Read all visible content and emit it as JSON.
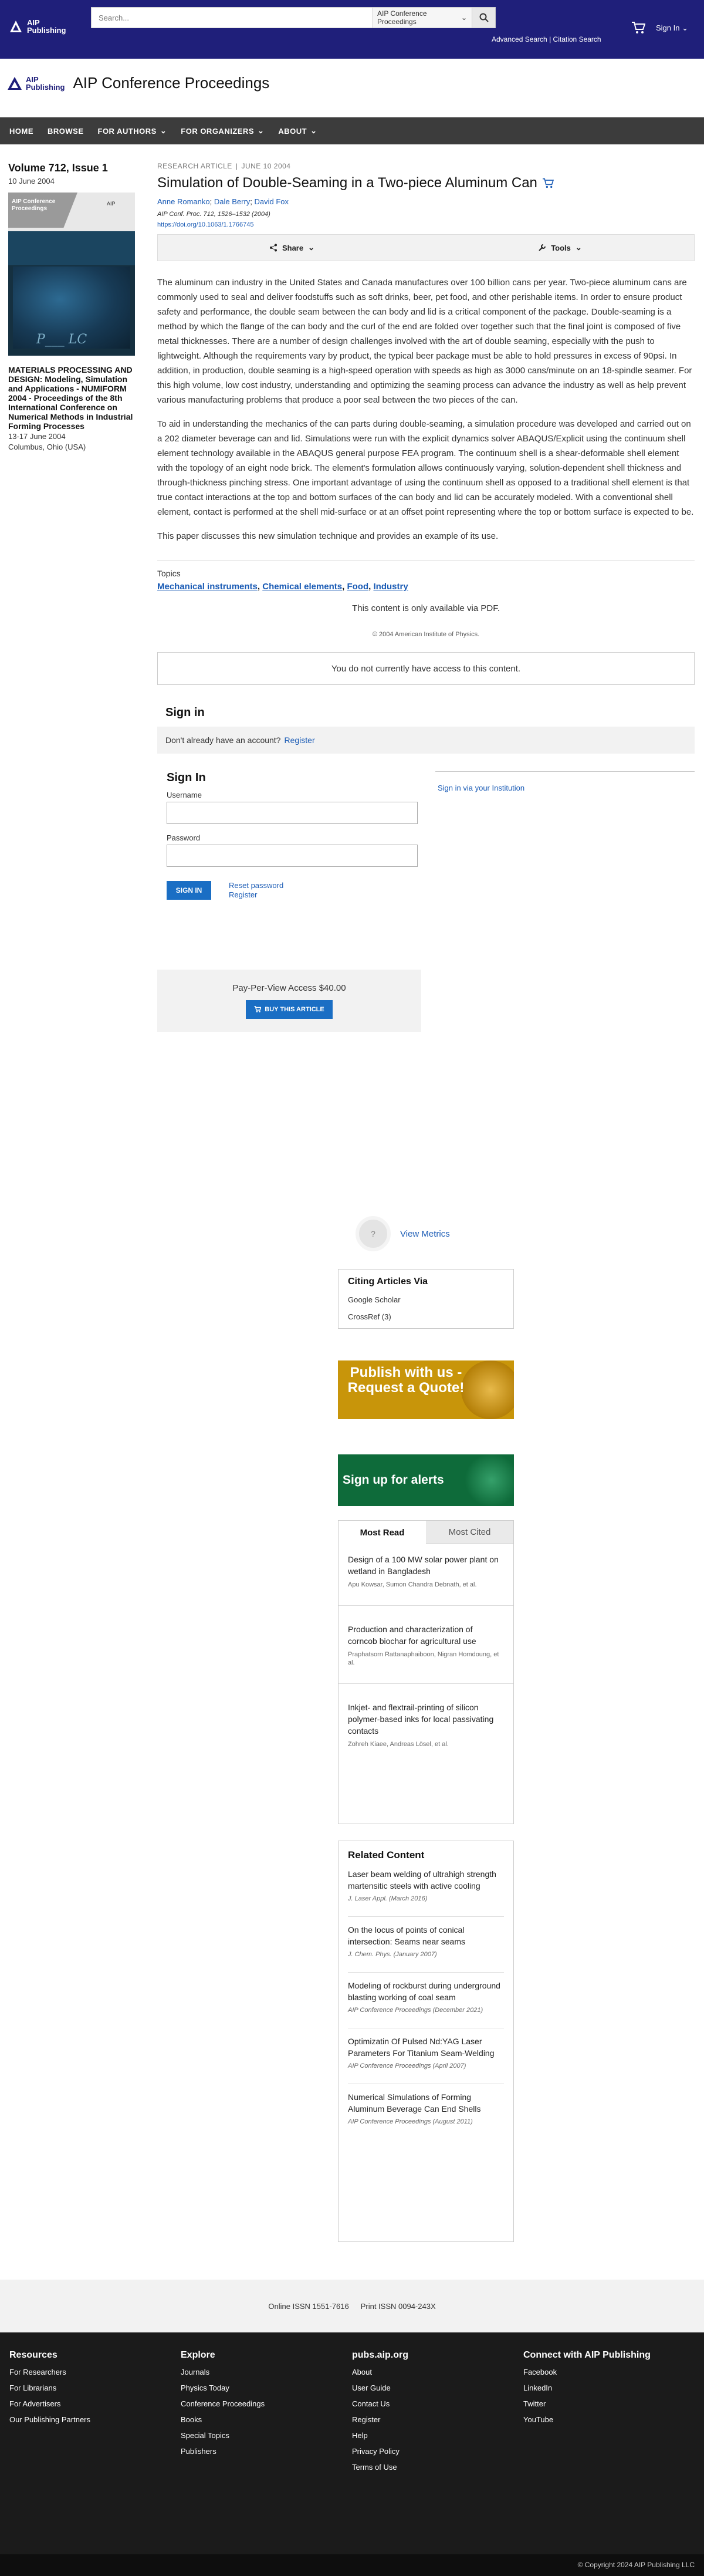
{
  "header": {
    "logo_line1": "AIP",
    "logo_line2": "Publishing",
    "search_placeholder": "Search...",
    "search_scope": "AIP Conference Proceedings",
    "advanced_search": "Advanced Search",
    "citation_search": "Citation Search",
    "separator": "|",
    "sign_in": "Sign In"
  },
  "brand": {
    "logo_line1": "AIP",
    "logo_line2": "Publishing",
    "journal": "AIP Conference Proceedings"
  },
  "nav": [
    "HOME",
    "BROWSE",
    "FOR AUTHORS",
    "FOR ORGANIZERS",
    "ABOUT"
  ],
  "sidebar": {
    "volume": "Volume 712, Issue 1",
    "date": "10 June 2004",
    "cover_title_1": "AIP Conference",
    "cover_title_2": "Proceedings",
    "cover_logo": "AIP",
    "cover_art_text": "P___ LC",
    "conf_title": "MATERIALS PROCESSING AND DESIGN: Modeling, Simulation and Applications - NUMIFORM 2004 - Proceedings of the 8th International Conference on Numerical Methods in Industrial Forming Processes",
    "conf_dates": "13-17 June 2004",
    "conf_place": "Columbus, Ohio (USA)"
  },
  "article": {
    "type": "RESEARCH ARTICLE",
    "pipe": "|",
    "date": "JUNE 10 2004",
    "title": "Simulation of Double‐Seaming in a Two‐piece Aluminum Can",
    "authors": [
      "Anne Romanko",
      "Dale Berry",
      "David Fox"
    ],
    "author_sep": "; ",
    "citation": "AIP Conf. Proc. 712, 1526–1532 (2004)",
    "doi": "https://doi.org/10.1063/1.1766745",
    "share": "Share",
    "tools": "Tools",
    "paragraphs": [
      "The aluminum can industry in the United States and Canada manufactures over 100 billion cans per year. Two-piece aluminum cans are commonly used to seal and deliver foodstuffs such as soft drinks, beer, pet food, and other perishable items. In order to ensure product safety and performance, the double seam between the can body and lid is a critical component of the package. Double-seaming is a method by which the flange of the can body and the curl of the end are folded over together such that the final joint is composed of five metal thicknesses. There are a number of design challenges involved with the art of double seaming, especially with the push to lightweight. Although the requirements vary by product, the typical beer package must be able to hold pressures in excess of 90psi. In addition, in production, double seaming is a high-speed operation with speeds as high as 3000 cans/minute on an 18-spindle seamer. For this high volume, low cost industry, understanding and optimizing the seaming process can advance the industry as well as help prevent various manufacturing problems that produce a poor seal between the two pieces of the can.",
      "To aid in understanding the mechanics of the can parts during double-seaming, a simulation procedure was developed and carried out on a 202 diameter beverage can and lid. Simulations were run with the explicit dynamics solver ABAQUS/Explicit using the continuum shell element technology available in the ABAQUS general purpose FEA program. The continuum shell is a shear-deformable shell element with the topology of an eight node brick. The element's formulation allows continuously varying, solution-dependent shell thickness and through-thickness pinching stress. One important advantage of using the continuum shell as opposed to a traditional shell element is that true contact interactions at the top and bottom surfaces of the can body and lid can be accurately modeled. With a conventional shell element, contact is performed at the shell mid-surface or at an offset point representing where the top or bottom surface is expected to be.",
      "This paper discusses this new simulation technique and provides an example of its use."
    ],
    "topics_heading": "Topics",
    "topics": [
      "Mechanical instruments",
      "Chemical elements",
      "Food",
      "Industry"
    ],
    "topic_sep": ", ",
    "pdf_only": "This content is only available via PDF.",
    "copyright": "© 2004 American Institute of Physics.",
    "no_access": "You do not currently have access to this content."
  },
  "signin_prompt": {
    "heading": "Sign in",
    "text": "Don't already have an account?",
    "register": "Register"
  },
  "signin_form": {
    "heading": "Sign In",
    "username_label": "Username",
    "password_label": "Password",
    "submit": "SIGN IN",
    "reset": "Reset password",
    "register": "Register",
    "institution": "Sign in via your Institution"
  },
  "ppv": {
    "price": "Pay-Per-View Access $40.00",
    "buy": "BUY THIS ARTICLE"
  },
  "metrics": {
    "badge": "?",
    "link": "View Metrics"
  },
  "citing": {
    "heading": "Citing Articles Via",
    "google": "Google Scholar",
    "crossref": "CrossRef (3)"
  },
  "ads": {
    "publish": "Publish with us - Request a Quote!",
    "alerts": "Sign up for alerts"
  },
  "most_read": {
    "tab_read": "Most Read",
    "tab_cited": "Most Cited",
    "entries": [
      {
        "title": "Design of a 100 MW solar power plant on wetland in Bangladesh",
        "authors": "Apu Kowsar, Sumon Chandra Debnath, et al."
      },
      {
        "title": "Production and characterization of corncob biochar for agricultural use",
        "authors": "Praphatsorn Rattanaphaiboon, Nigran Homdoung, et al."
      },
      {
        "title": "Inkjet- and flextrail-printing of silicon polymer-based inks for local passivating contacts",
        "authors": "Zohreh Kiaee, Andreas Lösel, et al."
      }
    ]
  },
  "related": {
    "heading": "Related Content",
    "entries": [
      {
        "title": "Laser beam welding of ultrahigh strength martensitic steels with active cooling",
        "source": "J. Laser Appl. (March 2016)"
      },
      {
        "title": "On the locus of points of conical intersection: Seams near seams",
        "source": "J. Chem. Phys. (January 2007)"
      },
      {
        "title": "Modeling of rockburst during underground blasting working of coal seam",
        "source": "AIP Conference Proceedings (December 2021)"
      },
      {
        "title": "Optimizatin Of Pulsed Nd:YAG Laser Parameters For Titanium Seam-Welding",
        "source": "AIP Conference Proceedings (April 2007)"
      },
      {
        "title": "Numerical Simulations of Forming Aluminum Beverage Can End Shells",
        "source": "AIP Conference Proceedings (August 2011)"
      }
    ]
  },
  "issn": {
    "online": "Online ISSN 1551-7616",
    "print": "Print ISSN 0094-243X"
  },
  "footer": {
    "resources": {
      "heading": "Resources",
      "links": [
        "For Researchers",
        "For Librarians",
        "For Advertisers",
        "Our Publishing Partners"
      ]
    },
    "explore": {
      "heading": "Explore",
      "links": [
        "Journals",
        "Physics Today",
        "Conference Proceedings",
        "Books",
        "Special Topics",
        "Publishers"
      ]
    },
    "pubs": {
      "heading": "pubs.aip.org",
      "links": [
        "About",
        "User Guide",
        "Contact Us",
        "Register",
        "Help",
        "Privacy Policy",
        "Terms of Use"
      ]
    },
    "connect": {
      "heading": "Connect with AIP Publishing",
      "links": [
        "Facebook",
        "LinkedIn",
        "Twitter",
        "YouTube"
      ]
    },
    "copyright": "© Copyright 2024 AIP Publishing LLC"
  },
  "colors": {
    "topbar": "#1f1f7a",
    "nav": "#3c3c3c",
    "link": "#1a5bb5",
    "button": "#1a6ec4",
    "ad_publish": "#c8950a",
    "ad_alerts": "#0e6b3a",
    "footer": "#1b1b1b"
  }
}
